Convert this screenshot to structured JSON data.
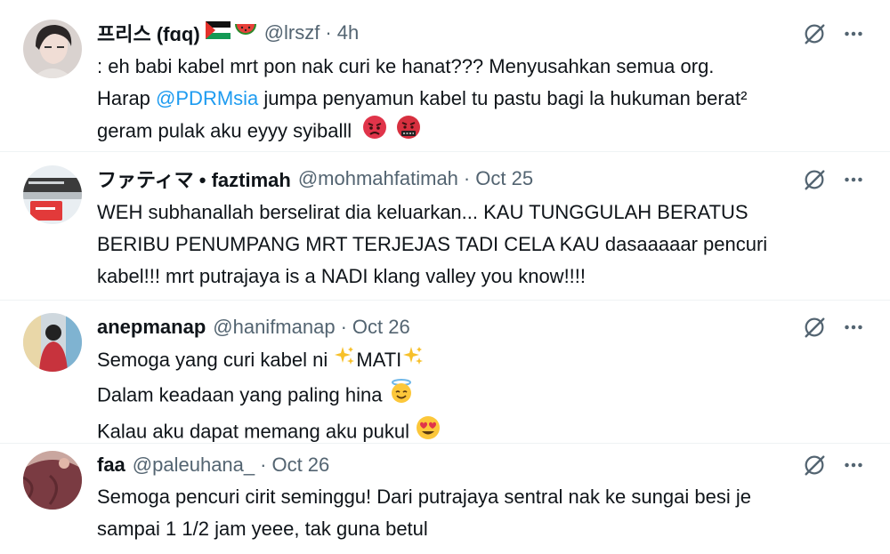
{
  "tweets": [
    {
      "name": "프리스 (fɑq)",
      "handle": "@lrszf",
      "sep": "·",
      "time": "4h",
      "lines": [
        ": eh babi kabel mrt pon nak curi ke hanat??? Menyusahkan semua org.",
        "Harap ",
        "geram pulak aku eyyy syiballl"
      ],
      "mention": "@PDRMsia",
      "line2_rest": " jumpa penyamun kabel tu pastu bagi la hukuman berat²"
    },
    {
      "name": "ファティマ • faztimah",
      "handle": "@mohmahfatimah",
      "sep": "·",
      "time": "Oct 25",
      "lines": [
        "WEH subhanallah berselirat dia keluarkan... KAU TUNGGULAH BERATUS",
        "BERIBU PENUMPANG MRT TERJEJAS TADI CELA KAU dasaaaaar pencuri",
        "kabel!!! mrt putrajaya is a NADI klang valley you know!!!!"
      ]
    },
    {
      "name": "anepmanap",
      "handle": "@hanifmanap",
      "sep": "·",
      "time": "Oct 26",
      "line1_pre": "Semoga yang curi kabel ni ",
      "line1_word": "MATI",
      "line2": "Dalam keadaan yang paling hina ",
      "line3": "Kalau aku dapat memang aku pukul "
    },
    {
      "name": "faa",
      "handle": "@paleuhana_",
      "sep": "·",
      "time": "Oct 26",
      "lines": [
        "Semoga pencuri cirit seminggu! Dari putrajaya sentral nak ke sungai besi je",
        "sampai 1 1/2 jam yeee, tak guna betul"
      ]
    }
  ],
  "icons": {
    "grok": "grok-icon",
    "more": "more-icon",
    "flag": "palestine-flag-icon",
    "watermelon": "watermelon-icon",
    "angry": "angry-face-icon",
    "cursing": "cursing-face-icon",
    "sparkles": "sparkles-icon",
    "halo": "smiling-face-with-halo-icon",
    "heart_eyes": "heart-eyes-icon"
  },
  "colors": {
    "text": "#0f1419",
    "muted": "#536471",
    "link": "#1d9bf0",
    "divider": "#eff3f4"
  }
}
